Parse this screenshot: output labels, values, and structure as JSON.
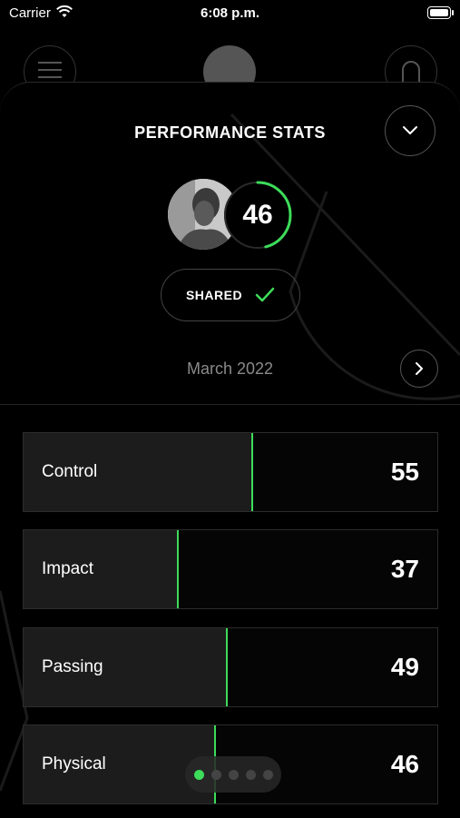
{
  "status_bar": {
    "carrier": "Carrier",
    "time": "6:08 p.m."
  },
  "header": {
    "title": "PERFORMANCE STATS"
  },
  "profile": {
    "score": "46",
    "score_fraction": 0.46
  },
  "shared": {
    "label": "SHARED"
  },
  "period": {
    "month": "March 2022"
  },
  "stats": [
    {
      "label": "Control",
      "value": "55",
      "fraction": 0.55
    },
    {
      "label": "Impact",
      "value": "37",
      "fraction": 0.37
    },
    {
      "label": "Passing",
      "value": "49",
      "fraction": 0.49
    },
    {
      "label": "Physical",
      "value": "46",
      "fraction": 0.46
    }
  ],
  "pager": {
    "count": 5,
    "active": 0
  },
  "colors": {
    "accent": "#3ddc5a",
    "background": "#000000",
    "card": "#1c1c1c"
  }
}
